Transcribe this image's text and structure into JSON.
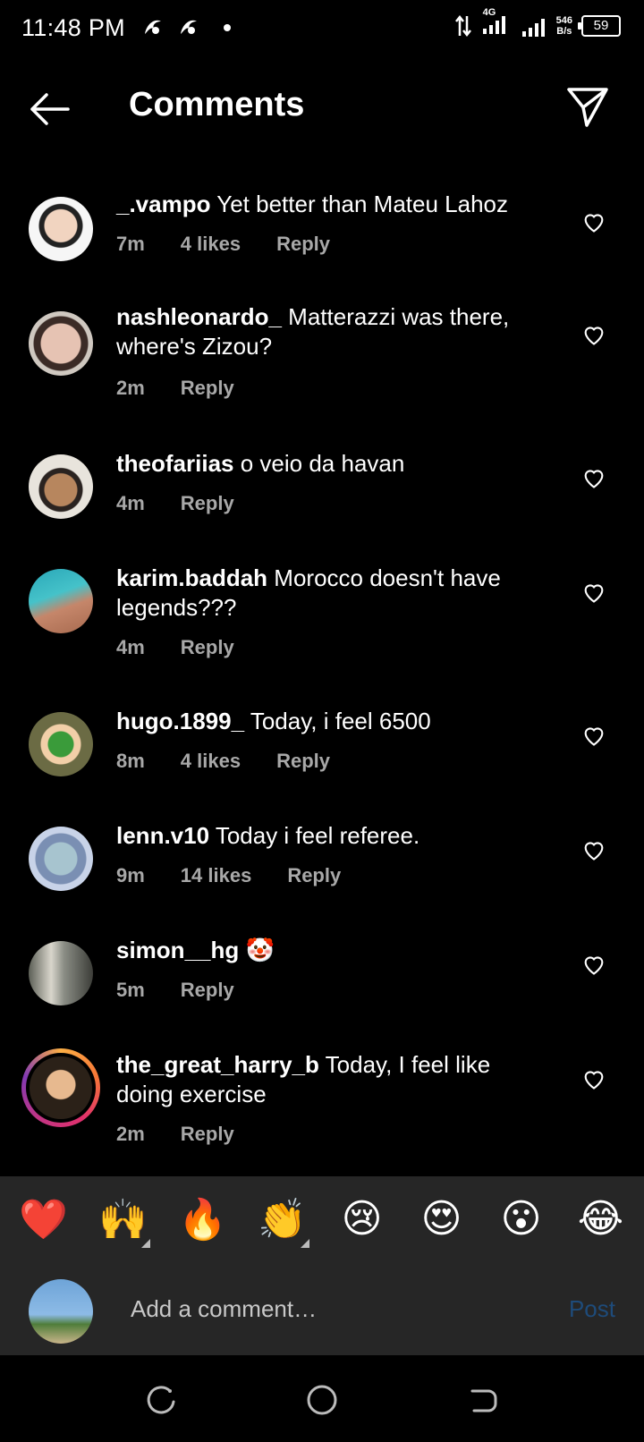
{
  "status": {
    "time": "11:48 PM",
    "network": "4G",
    "speed_value": "546",
    "speed_unit": "B/s",
    "battery": "59"
  },
  "header": {
    "title": "Comments",
    "back_icon": "arrow-left-icon",
    "send_icon": "paper-plane-icon"
  },
  "comments": [
    {
      "user": "_.vampo",
      "text": "Yet better than Mateu Lahoz",
      "time": "7m",
      "likes": "4 likes",
      "reply": "Reply"
    },
    {
      "user": "nashleonardo_",
      "text": "Matterazzi was there, where's Zizou?",
      "time": "2m",
      "likes": "",
      "reply": "Reply"
    },
    {
      "user": "theofariias",
      "text": "o veio da havan",
      "time": "4m",
      "likes": "",
      "reply": "Reply"
    },
    {
      "user": "karim.baddah",
      "text": "Morocco doesn't have legends???",
      "time": "4m",
      "likes": "",
      "reply": "Reply"
    },
    {
      "user": "hugo.1899_",
      "text": "Today, i feel 6500",
      "time": "8m",
      "likes": "4 likes",
      "reply": "Reply"
    },
    {
      "user": "lenn.v10",
      "text": "Today i feel referee.",
      "time": "9m",
      "likes": "14 likes",
      "reply": "Reply"
    },
    {
      "user": "simon__hg",
      "text": "🤡",
      "time": "5m",
      "likes": "",
      "reply": "Reply"
    },
    {
      "user": "the_great_harry_b",
      "text": "Today, I feel like doing exercise",
      "time": "2m",
      "likes": "",
      "reply": "Reply"
    }
  ],
  "reactions": [
    "❤️",
    "🙌",
    "🔥",
    "👏",
    "😢",
    "😍",
    "😮",
    "😂"
  ],
  "composer": {
    "placeholder": "Add a comment…",
    "post_label": "Post"
  },
  "colors": {
    "background": "#000000",
    "secondary_text": "#a8a8a8",
    "bar": "#262626",
    "post_disabled": "#1e4b7a"
  }
}
